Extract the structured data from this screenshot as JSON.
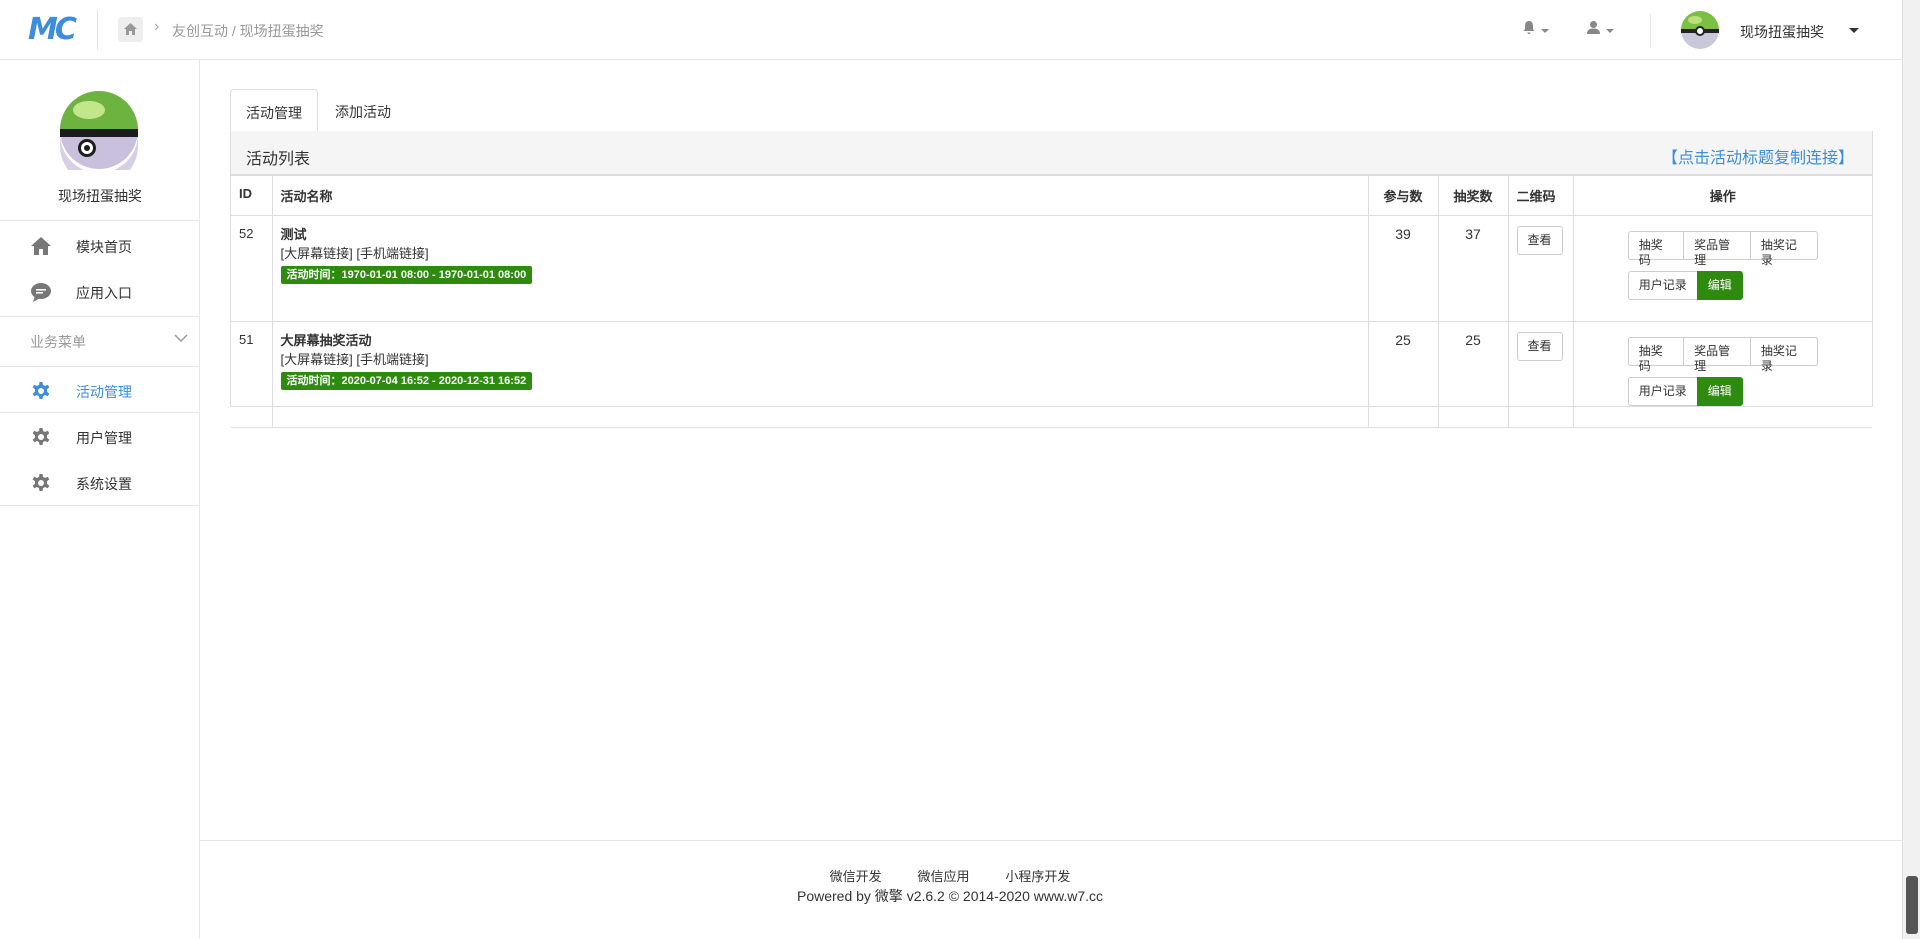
{
  "header": {
    "logo_text": "MC",
    "breadcrumb": "友创互动 / 现场扭蛋抽奖",
    "account_name": "现场扭蛋抽奖"
  },
  "sidebar": {
    "module_title": "现场扭蛋抽奖",
    "top_items": [
      {
        "label": "模块首页",
        "icon": "home-icon"
      },
      {
        "label": "应用入口",
        "icon": "chat-icon"
      }
    ],
    "group_label": "业务菜单",
    "group_items": [
      {
        "label": "活动管理",
        "icon": "gear-icon",
        "active": true
      },
      {
        "label": "用户管理",
        "icon": "gear-icon",
        "active": false
      },
      {
        "label": "系统设置",
        "icon": "gear-icon",
        "active": false
      }
    ]
  },
  "tabs": [
    {
      "label": "活动管理",
      "active": true
    },
    {
      "label": "添加活动",
      "active": false
    }
  ],
  "panel": {
    "title": "活动列表",
    "hint_link": "【点击活动标题复制连接】"
  },
  "table": {
    "headers": {
      "id": "ID",
      "name": "活动名称",
      "participants": "参与数",
      "draws": "抽奖数",
      "qrcode": "二维码",
      "ops": "操作"
    },
    "rows": [
      {
        "id": "52",
        "title": "测试",
        "links": "[大屏幕链接] [手机端链接]",
        "time": "活动时间：1970-01-01 08:00 - 1970-01-01 08:00",
        "participants": "39",
        "draws": "37",
        "qr_btn": "查看",
        "ops": {
          "code": "抽奖码",
          "prize": "奖品管理",
          "record": "抽奖记录",
          "user": "用户记录",
          "edit": "编辑"
        }
      },
      {
        "id": "51",
        "title": "大屏幕抽奖活动",
        "links": "[大屏幕链接] [手机端链接]",
        "time": "活动时间：2020-07-04 16:52 - 2020-12-31 16:52",
        "participants": "25",
        "draws": "25",
        "qr_btn": "查看",
        "ops": {
          "code": "抽奖码",
          "prize": "奖品管理",
          "record": "抽奖记录",
          "user": "用户记录",
          "edit": "编辑"
        }
      }
    ]
  },
  "footer": {
    "links": [
      "微信开发",
      "微信应用",
      "小程序开发"
    ],
    "copyright": "Powered by 微擎 v2.6.2 © 2014-2020 www.w7.cc"
  },
  "colors": {
    "accent": "#3c8ddc",
    "success": "#2e8b0f"
  }
}
